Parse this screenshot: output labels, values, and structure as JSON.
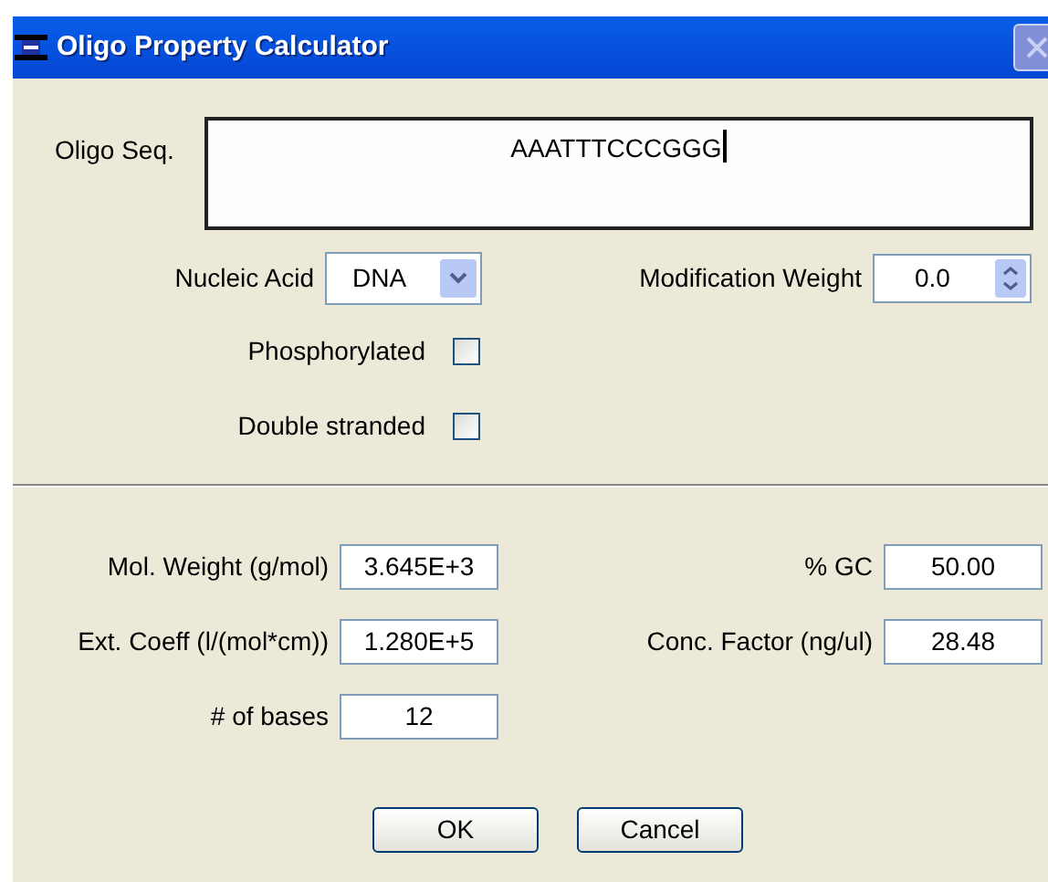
{
  "window": {
    "title": "Oligo Property Calculator"
  },
  "sequence": {
    "label": "Oligo Seq.",
    "value": "AAATTTCCCGGG"
  },
  "nucleic_acid": {
    "label": "Nucleic Acid",
    "value": "DNA"
  },
  "modification_weight": {
    "label": "Modification Weight",
    "value": "0.0"
  },
  "options": [
    {
      "label": "Phosphorylated",
      "checked": false
    },
    {
      "label": "Double stranded",
      "checked": false
    }
  ],
  "results": [
    {
      "label": "Mol. Weight (g/mol)",
      "value": "3.645E+3"
    },
    {
      "label": "% GC",
      "value": "50.00"
    },
    {
      "label": "Ext. Coeff (l/(mol*cm))",
      "value": "1.280E+5"
    },
    {
      "label": "Conc. Factor (ng/ul)",
      "value": "28.48"
    },
    {
      "label": "# of bases",
      "value": "12"
    }
  ],
  "buttons": [
    {
      "label": "OK"
    },
    {
      "label": "Cancel"
    }
  ]
}
